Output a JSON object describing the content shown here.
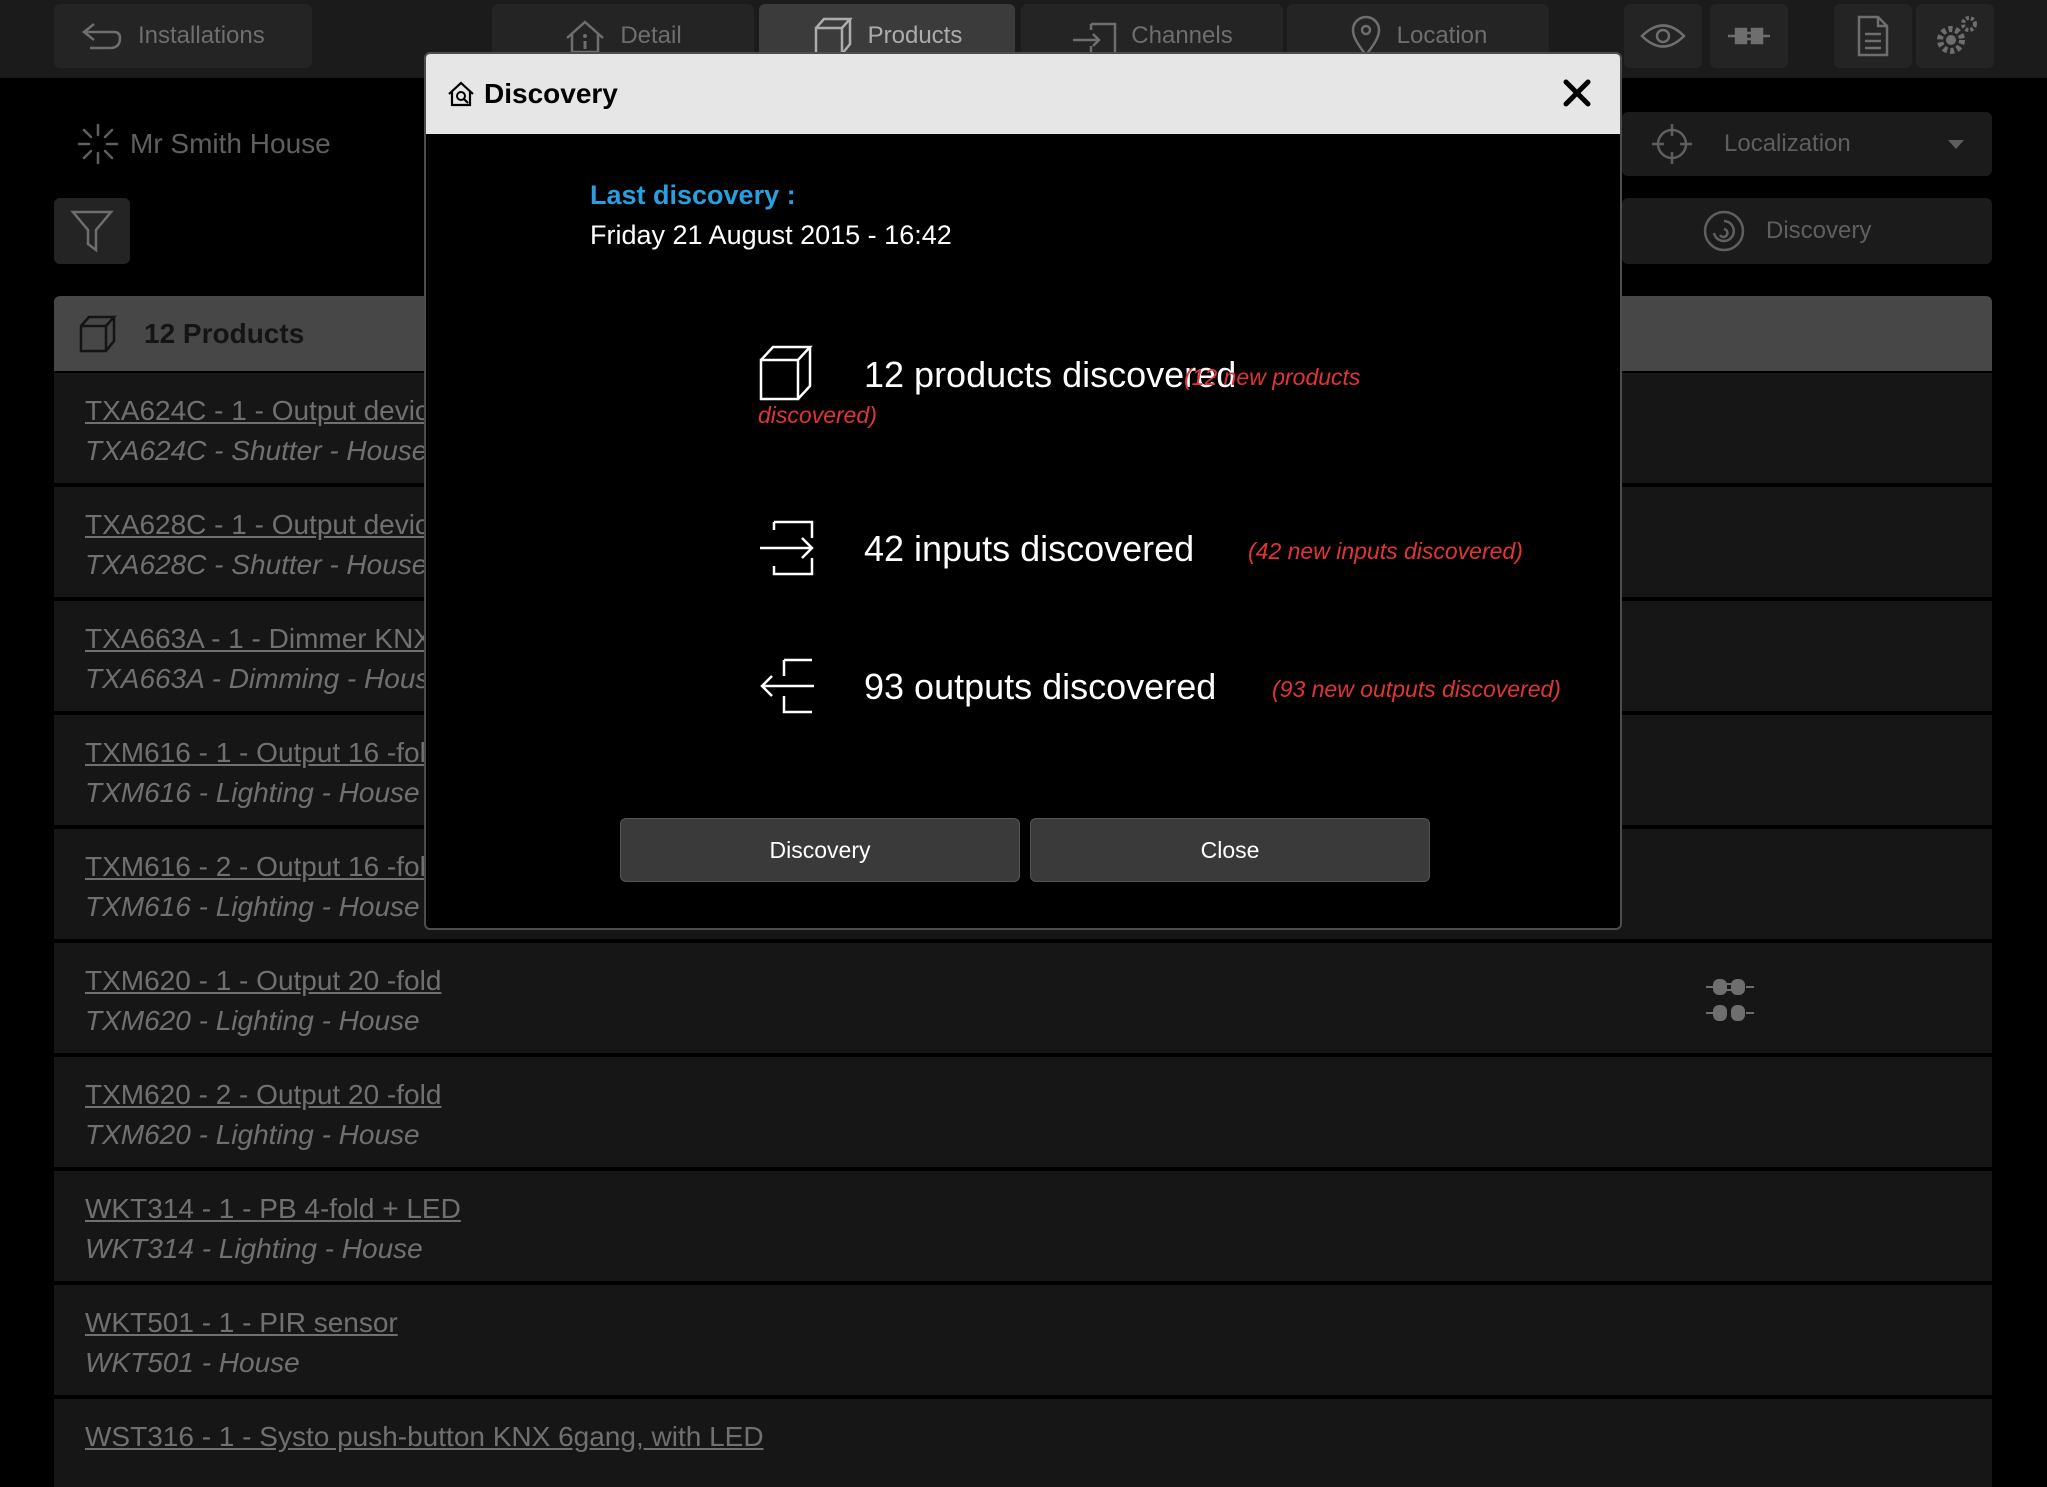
{
  "topbar": {
    "installations_label": "Installations",
    "tabs": [
      {
        "label": "Detail",
        "icon": "info-house-icon"
      },
      {
        "label": "Products",
        "icon": "box-icon",
        "active": true
      },
      {
        "label": "Channels",
        "icon": "channels-icon"
      },
      {
        "label": "Location",
        "icon": "location-pin-icon"
      }
    ],
    "right_icons": [
      "eye-icon",
      "plug-icon",
      "document-icon",
      "gear-icon"
    ]
  },
  "installation": {
    "name": "Mr Smith House",
    "status_icon": "loading-spinner-icon"
  },
  "localization_select": {
    "label": "Localization",
    "icon": "crosshair-icon"
  },
  "discovery_button": {
    "label": "Discovery",
    "icon": "discovery-icon"
  },
  "product_list": {
    "header": "12 Products",
    "rows": [
      {
        "title": "TXA624C - 1 - Output devic",
        "subtitle": "TXA624C - Shutter - House"
      },
      {
        "title": "TXA628C - 1 - Output devic",
        "subtitle": "TXA628C - Shutter - House"
      },
      {
        "title": "TXA663A - 1 - Dimmer KNX",
        "subtitle": "TXA663A - Dimming - Hous"
      },
      {
        "title": "TXM616 - 1 - Output 16 -fol",
        "subtitle": "TXM616 - Lighting - House"
      },
      {
        "title": "TXM616 - 2 - Output 16 -fol",
        "subtitle": "TXM616 - Lighting - House"
      },
      {
        "title": "TXM620 - 1 - Output 20 -fold",
        "subtitle": "TXM620 - Lighting - House",
        "icon": "plug-connect-icon"
      },
      {
        "title": "TXM620 - 2 - Output 20 -fold",
        "subtitle": "TXM620 - Lighting - House"
      },
      {
        "title": "WKT314 - 1 - PB 4-fold + LED",
        "subtitle": "WKT314 - Lighting - House"
      },
      {
        "title": "WKT501 - 1 - PIR sensor",
        "subtitle": "WKT501 - House"
      },
      {
        "title": "WST316 - 1 - Systo push-button KNX 6gang, with LED",
        "subtitle": ""
      }
    ]
  },
  "dialog": {
    "title": "Discovery",
    "last_discovery_label": "Last discovery :",
    "last_discovery_value": "Friday 21 August 2015 - 16:42",
    "stats": {
      "products": {
        "text": "12 products discovered",
        "note_line1": "(12 new products",
        "note_line2": "discovered)"
      },
      "inputs": {
        "text": "42 inputs discovered",
        "note": "(42 new inputs discovered)"
      },
      "outputs": {
        "text": "93 outputs discovered",
        "note": "(93 new outputs discovered)"
      }
    },
    "discovery_button": "Discovery",
    "close_button": "Close"
  },
  "colors": {
    "accent_blue": "#2a9fe0",
    "note_red": "#e03535",
    "header_bg": "#e6e6e6"
  }
}
